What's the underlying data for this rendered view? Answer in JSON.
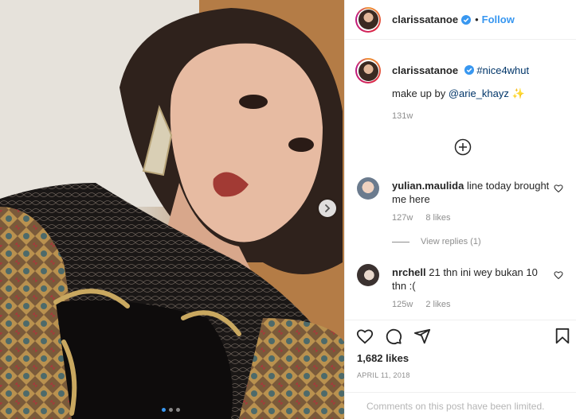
{
  "post": {
    "author": "clarissatanoe",
    "follow_label": "Follow",
    "bullet": "•",
    "caption_hashtag": "#nice4whut",
    "caption_text": "make up by ",
    "caption_mention": "@arie_khayz",
    "caption_emoji": "✨",
    "caption_time": "131w",
    "likes": "1,682 likes",
    "date": "APRIL 11, 2018",
    "comments_limited": "Comments on this post have been limited."
  },
  "comments": [
    {
      "user": "yulian.maulida",
      "text": "line today brought me here",
      "time": "127w",
      "likes": "8 likes",
      "view_replies": "View replies (1)"
    },
    {
      "user": "nrchell",
      "text": "21 thn ini wey bukan 10 thn :(",
      "time": "125w",
      "likes": "2 likes"
    }
  ],
  "carousel": {
    "slides": 3,
    "active": 1
  },
  "colors": {
    "link": "#3897f0",
    "meta": "#8e8e8e",
    "verified": "#3897f0"
  },
  "icons": [
    "verified-badge-icon",
    "add-circle-icon",
    "heart-icon",
    "comment-icon",
    "share-icon",
    "bookmark-icon",
    "chevron-right-icon"
  ]
}
